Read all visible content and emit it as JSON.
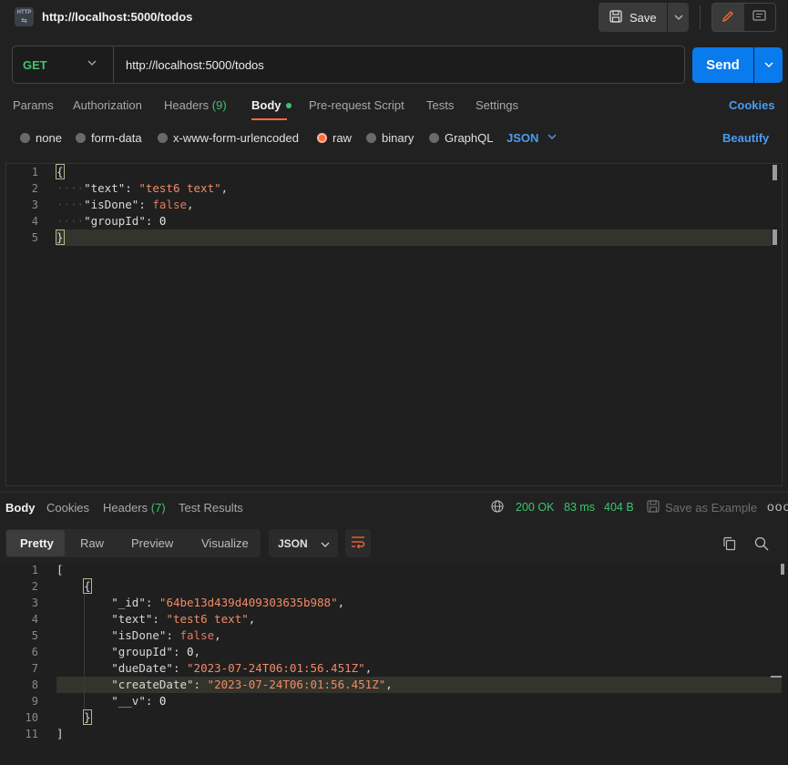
{
  "titlebar": {
    "badge": "HTTP",
    "title": "http://localhost:5000/todos",
    "save_label": "Save"
  },
  "request": {
    "method": "GET",
    "url": "http://localhost:5000/todos",
    "send_label": "Send"
  },
  "request_tabs": [
    {
      "label": "Params"
    },
    {
      "label": "Authorization"
    },
    {
      "label": "Headers",
      "count": "(9)"
    },
    {
      "label": "Body"
    },
    {
      "label": "Pre-request Script"
    },
    {
      "label": "Tests"
    },
    {
      "label": "Settings"
    }
  ],
  "cookies_label": "Cookies",
  "body_types": [
    {
      "label": "none",
      "selected": false
    },
    {
      "label": "form-data",
      "selected": false
    },
    {
      "label": "x-www-form-urlencoded",
      "selected": false
    },
    {
      "label": "raw",
      "selected": true
    },
    {
      "label": "binary",
      "selected": false
    },
    {
      "label": "GraphQL",
      "selected": false
    }
  ],
  "raw_format": "JSON",
  "beautify_label": "Beautify",
  "request_body": {
    "line_numbers": [
      "1",
      "2",
      "3",
      "4",
      "5"
    ],
    "open_brace": "{",
    "close_brace": "}",
    "fields": [
      {
        "key": "\"text\"",
        "value": "\"test6 text\"",
        "type": "string",
        "comma": ","
      },
      {
        "key": "\"isDone\"",
        "value": "false",
        "type": "bool",
        "comma": ","
      },
      {
        "key": "\"groupId\"",
        "value": "0",
        "type": "number",
        "comma": ""
      }
    ]
  },
  "response_tabs": [
    {
      "label": "Body"
    },
    {
      "label": "Cookies"
    },
    {
      "label": "Headers",
      "count": "(7)"
    },
    {
      "label": "Test Results"
    }
  ],
  "response_status": {
    "status": "200 OK",
    "time": "83 ms",
    "size": "404 B",
    "save_example": "Save as Example",
    "more": "ooo"
  },
  "view_modes": [
    "Pretty",
    "Raw",
    "Preview",
    "Visualize"
  ],
  "response_format": "JSON",
  "response_body": {
    "line_numbers": [
      "1",
      "2",
      "3",
      "4",
      "5",
      "6",
      "7",
      "8",
      "9",
      "10",
      "11"
    ],
    "open_bracket": "[",
    "close_bracket": "]",
    "open_brace": "{",
    "close_brace": "}",
    "fields": [
      {
        "key": "\"_id\"",
        "value": "\"64be13d439d409303635b988\"",
        "type": "string",
        "comma": ","
      },
      {
        "key": "\"text\"",
        "value": "\"test6 text\"",
        "type": "string",
        "comma": ","
      },
      {
        "key": "\"isDone\"",
        "value": "false",
        "type": "bool",
        "comma": ","
      },
      {
        "key": "\"groupId\"",
        "value": "0",
        "type": "number",
        "comma": ","
      },
      {
        "key": "\"dueDate\"",
        "value": "\"2023-07-24T06:01:56.451Z\"",
        "type": "string",
        "comma": ","
      },
      {
        "key": "\"createDate\"",
        "value": "\"2023-07-24T06:01:56.451Z\"",
        "type": "string",
        "comma": ","
      },
      {
        "key": "\"__v\"",
        "value": "0",
        "type": "number",
        "comma": ""
      }
    ]
  },
  "colors": {
    "accent": "#ff6c37",
    "send": "#097bed",
    "success": "#3ec470",
    "link": "#4a9cf0"
  }
}
